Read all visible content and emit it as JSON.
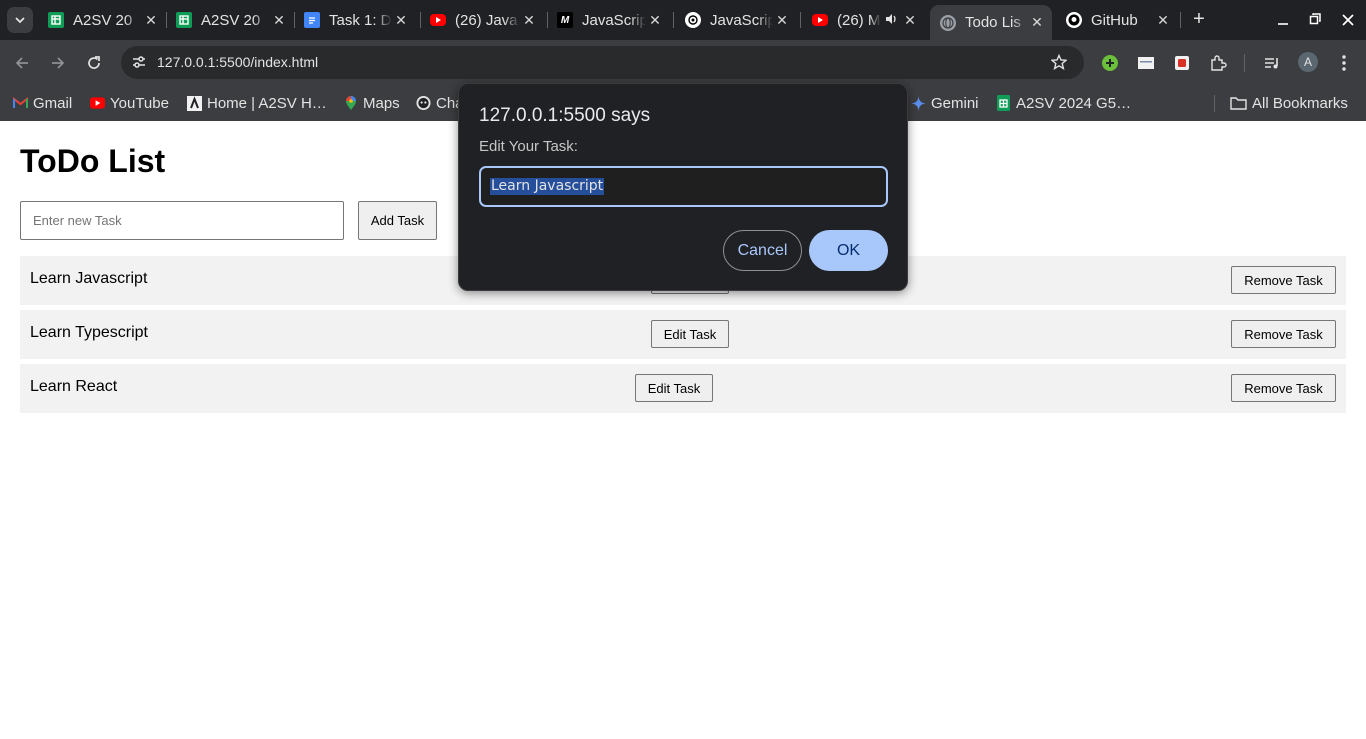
{
  "browser": {
    "tabs": [
      {
        "title": "A2SV 20",
        "icon": "google-sheets-icon",
        "color": "#0f9d58"
      },
      {
        "title": "A2SV 20",
        "icon": "google-sheets-icon",
        "color": "#0f9d58"
      },
      {
        "title": "Task 1: D",
        "icon": "google-docs-icon",
        "color": "#4285f4"
      },
      {
        "title": "(26) Java",
        "icon": "youtube-icon",
        "color": "#ff0000"
      },
      {
        "title": "JavaScrip",
        "icon": "medium-icon",
        "color": "#000000"
      },
      {
        "title": "JavaScrip",
        "icon": "chatgpt-icon",
        "color": "#ffffff"
      },
      {
        "title": "(26) M",
        "icon": "youtube-icon",
        "color": "#ff0000"
      },
      {
        "title": "Todo Lis",
        "icon": "globe-icon",
        "color": "#9aa0a6"
      },
      {
        "title": "GitHub",
        "icon": "github-icon",
        "color": "#ffffff"
      }
    ],
    "active_tab_index": 7,
    "url": "127.0.0.1:5500/index.html",
    "bookmarks": [
      {
        "label": "Gmail",
        "icon": "gmail-icon"
      },
      {
        "label": "YouTube",
        "icon": "youtube-icon"
      },
      {
        "label": "Home | A2SV H…",
        "icon": "a2sv-icon"
      },
      {
        "label": "Maps",
        "icon": "maps-pin-icon"
      },
      {
        "label": "Cha",
        "icon": "chat-bot-icon"
      },
      {
        "label": "Gemini",
        "icon": "gemini-sparkle-icon"
      },
      {
        "label": "A2SV 2024 G5…",
        "icon": "google-sheets-icon"
      },
      {
        "label": "All Bookmarks",
        "icon": "folder-icon"
      }
    ],
    "avatar_letter": "A"
  },
  "page": {
    "title": "ToDo List",
    "input_placeholder": "Enter new Task",
    "add_button": "Add Task",
    "edit_button": "Edit Task",
    "remove_button": "Remove Task",
    "tasks": [
      "Learn Javascript",
      "Learn Typescript",
      "Learn React"
    ]
  },
  "dialog": {
    "title": "127.0.0.1:5500 says",
    "message": "Edit Your Task:",
    "input_value": "Learn Javascript",
    "cancel_label": "Cancel",
    "ok_label": "OK"
  },
  "colors": {
    "chrome_bg": "#202124",
    "toolbar_bg": "#3c3d40",
    "dialog_accent": "#a8c7fa",
    "task_row_bg": "#f2f2f2"
  }
}
